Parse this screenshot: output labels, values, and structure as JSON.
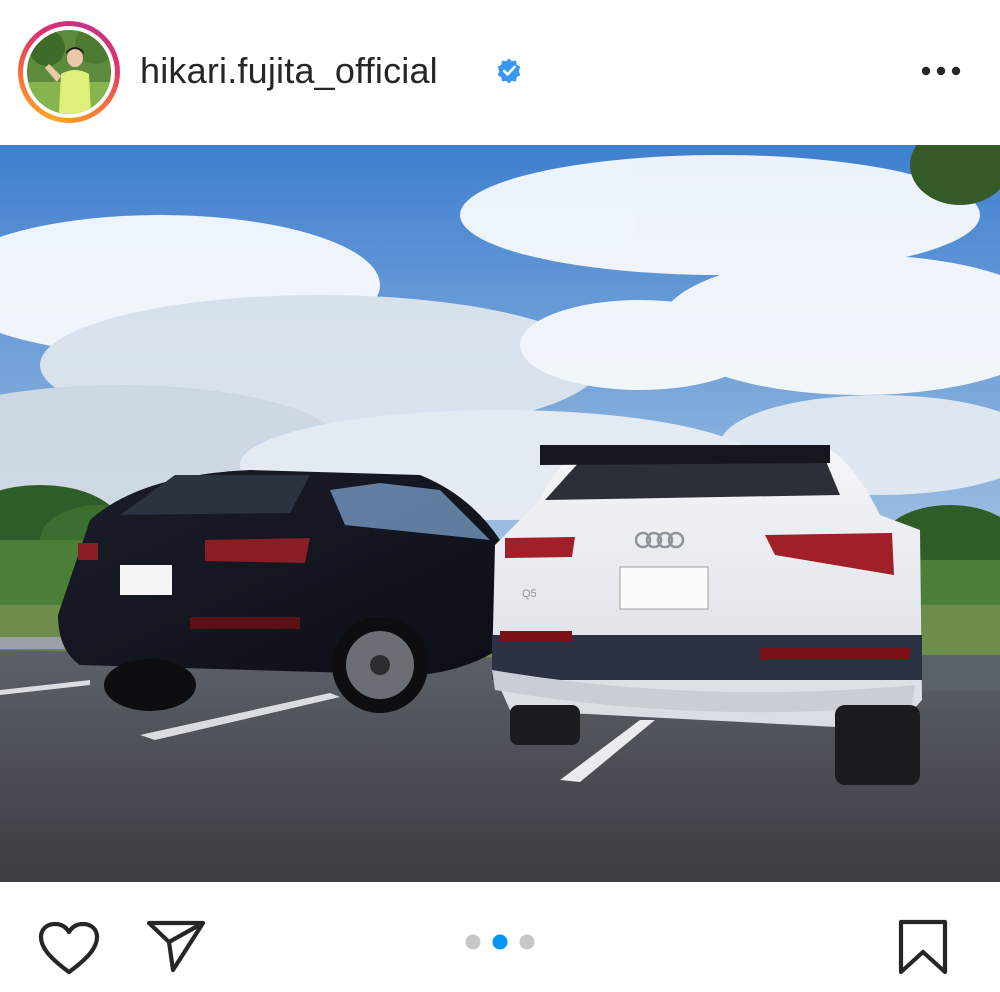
{
  "post": {
    "username": "hikari.fujita_official",
    "verified": true,
    "more_icon": "more-horizontal-icon",
    "avatar_icon": "profile-avatar"
  },
  "photo": {
    "carousel_total": 3,
    "carousel_active_index": 1,
    "car_badge_white": "Q5"
  },
  "actions": {
    "like_icon": "heart-outline-icon",
    "share_icon": "paper-plane-icon",
    "save_icon": "bookmark-outline-icon"
  },
  "colors": {
    "verified_blue": "#3897f0",
    "dot_active": "#0095f6",
    "dot_inactive": "#c7c7c7",
    "text": "#262626"
  }
}
